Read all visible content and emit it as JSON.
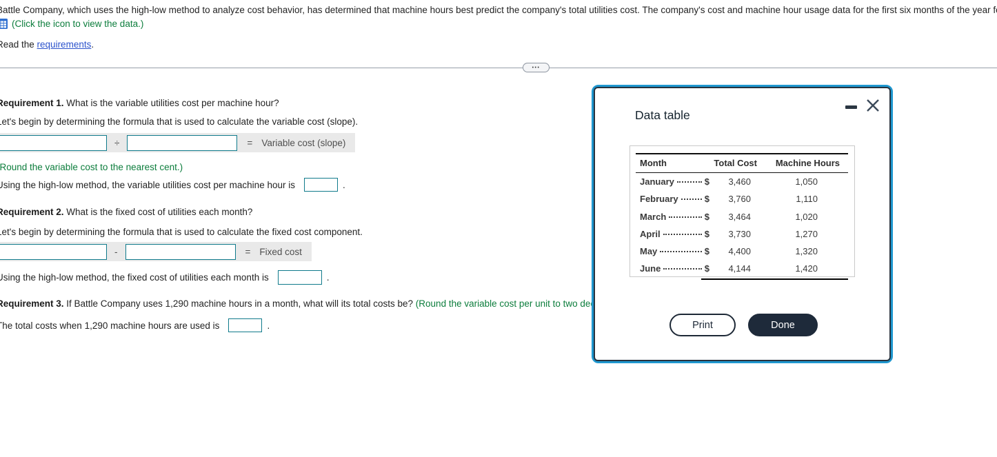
{
  "problem": {
    "intro": "Battle Company, which uses the high-low method to analyze cost behavior, has determined that machine hours best predict the company's total utilities cost. The company's cost and machine hour usage data for the first six months of the year follow:",
    "data_link_note": "(Click the icon to view the data.)",
    "read_prefix": "Read the ",
    "requirements_link": "requirements",
    "read_suffix": "."
  },
  "divider": {
    "toggle_label": "•••"
  },
  "requirement1": {
    "heading": "Requirement 1.",
    "question": " What is the variable utilities cost per machine hour?",
    "intro": "Let's begin by determining the formula that is used to calculate the variable cost (slope).",
    "formula": {
      "operator": "÷",
      "equals": "=",
      "result_label": "Variable cost (slope)"
    },
    "round_note": "(Round the variable cost to the nearest cent.)",
    "answer_prefix": "Using the high-low method, the variable utilities cost per machine hour is",
    "answer_suffix": "."
  },
  "requirement2": {
    "heading": "Requirement 2.",
    "question": " What is the fixed cost of utilities each month?",
    "intro": "Let's begin by determining the formula that is used to calculate the fixed cost component.",
    "formula": {
      "operator": "-",
      "equals": "=",
      "result_label": "Fixed cost"
    },
    "answer_prefix": "Using the high-low method, the fixed cost of utilities each month is",
    "answer_suffix": "."
  },
  "requirement3": {
    "heading": "Requirement 3.",
    "question": " If Battle Company uses 1,290 machine hours in a month, what will its total costs be? ",
    "round_note": "(Round the variable cost per unit to two decimal",
    "answer_prefix": "The total costs when 1,290 machine hours are used is",
    "answer_suffix": "."
  },
  "dialog": {
    "title": "Data table",
    "table": {
      "headers": [
        "Month",
        "Total Cost",
        "Machine Hours"
      ],
      "currency_symbol": "$",
      "rows": [
        {
          "month": "January",
          "total_cost": "3,460",
          "machine_hours": "1,050"
        },
        {
          "month": "February",
          "total_cost": "3,760",
          "machine_hours": "1,110"
        },
        {
          "month": "March",
          "total_cost": "3,464",
          "machine_hours": "1,020"
        },
        {
          "month": "April",
          "total_cost": "3,730",
          "machine_hours": "1,270"
        },
        {
          "month": "May",
          "total_cost": "4,400",
          "machine_hours": "1,320"
        },
        {
          "month": "June",
          "total_cost": "4,144",
          "machine_hours": "1,420"
        }
      ]
    },
    "buttons": {
      "print": "Print",
      "done": "Done"
    }
  },
  "colors": {
    "accent_green": "#0c7d3c",
    "link_blue": "#2b52cc",
    "input_border_teal": "#0f7a8b",
    "dialog_border_blue": "#1f97cf",
    "dialog_dark_navy": "#1e2a3a",
    "formula_strip_gray": "#e9e9e9"
  }
}
